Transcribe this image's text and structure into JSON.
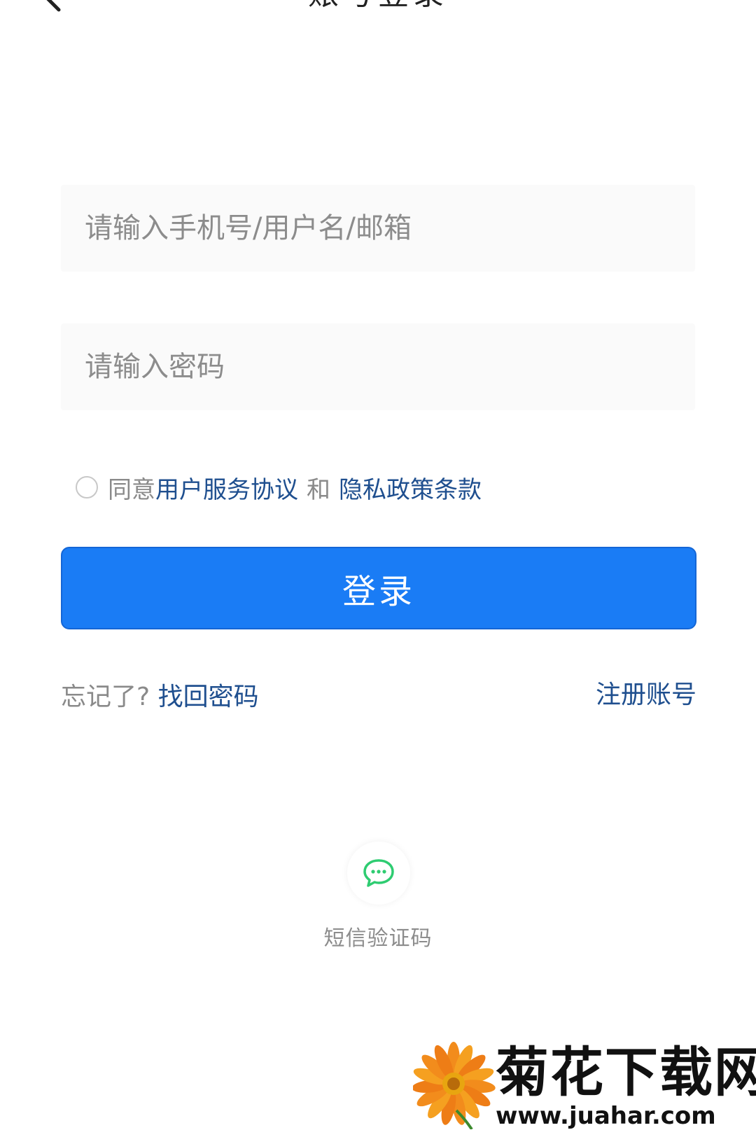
{
  "header": {
    "title": "账号登录"
  },
  "form": {
    "account_placeholder": "请输入手机号/用户名/邮箱",
    "password_placeholder": "请输入密码"
  },
  "agreement": {
    "agree_text": "同意",
    "user_agreement": "用户服务协议",
    "and_text": "和",
    "privacy_policy": "隐私政策条款"
  },
  "login": {
    "button_label": "登录"
  },
  "links": {
    "forgot_prefix": "忘记了?",
    "recover_password": "找回密码",
    "register": "注册账号"
  },
  "alt_login": {
    "sms_label": "短信验证码"
  },
  "watermark": {
    "title": "菊花下载网",
    "url": "www.juahar.com"
  },
  "colors": {
    "primary": "#1a7cf5",
    "link": "#1f4f8f",
    "sms_icon": "#2ecc71"
  }
}
